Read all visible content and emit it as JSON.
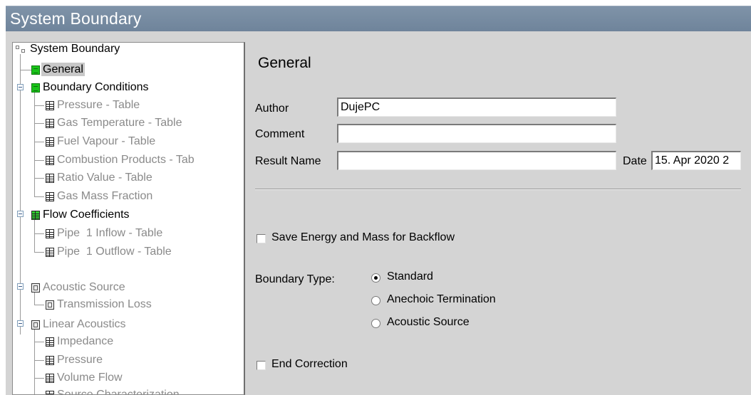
{
  "window": {
    "title": "System Boundary"
  },
  "tree": {
    "root": "System Boundary",
    "items": [
      {
        "label": "General",
        "selected": true,
        "enabled": true,
        "icon": "green-box-icon"
      },
      {
        "label": "Boundary Conditions",
        "enabled": true,
        "icon": "green-box-icon"
      },
      {
        "label": "Pressure - Table",
        "enabled": false,
        "icon": "table-icon"
      },
      {
        "label": "Gas Temperature - Table",
        "enabled": false,
        "icon": "table-icon"
      },
      {
        "label": "Fuel Vapour - Table",
        "enabled": false,
        "icon": "table-icon"
      },
      {
        "label": "Combustion Products - Tab",
        "enabled": false,
        "icon": "table-icon"
      },
      {
        "label": "Ratio Value - Table",
        "enabled": false,
        "icon": "table-icon"
      },
      {
        "label": "Gas Mass Fraction",
        "enabled": false,
        "icon": "table-icon"
      },
      {
        "label": "Flow Coefficients",
        "enabled": true,
        "icon": "green-table-icon"
      },
      {
        "label": "Pipe  1 Inflow - Table",
        "enabled": false,
        "icon": "table-icon"
      },
      {
        "label": "Pipe  1 Outflow - Table",
        "enabled": false,
        "icon": "table-icon"
      },
      {
        "label": "Acoustic Source",
        "enabled": false,
        "icon": "box-icon"
      },
      {
        "label": "Transmission Loss",
        "enabled": false,
        "icon": "box-icon"
      },
      {
        "label": "Linear Acoustics",
        "enabled": false,
        "icon": "box-icon"
      },
      {
        "label": "Impedance",
        "enabled": false,
        "icon": "table-icon"
      },
      {
        "label": "Pressure",
        "enabled": false,
        "icon": "table-icon"
      },
      {
        "label": "Volume Flow",
        "enabled": false,
        "icon": "table-icon"
      },
      {
        "label": "Source Characterization",
        "enabled": false,
        "icon": "table-icon"
      }
    ]
  },
  "general": {
    "title": "General",
    "author_label": "Author",
    "author_value": "DujePC",
    "comment_label": "Comment",
    "comment_value": "",
    "result_name_label": "Result Name",
    "result_name_value": "",
    "date_label": "Date",
    "date_value": "15. Apr 2020 2",
    "save_energy_label": "Save Energy and Mass for Backflow",
    "save_energy_checked": false,
    "boundary_type_label": "Boundary Type:",
    "boundary_options": [
      "Standard",
      "Anechoic Termination",
      "Acoustic Source"
    ],
    "boundary_selected": "Standard",
    "end_correction_label": "End Correction",
    "end_correction_checked": false
  },
  "colors": {
    "titlebar": "#7388a0",
    "panel": "#d4d4d4",
    "enabled_icon": "#19c419"
  }
}
